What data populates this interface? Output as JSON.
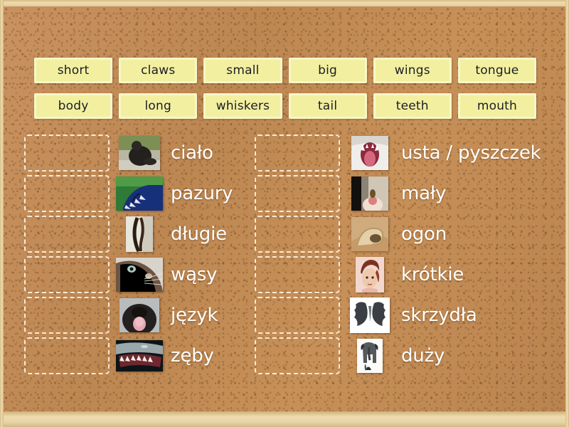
{
  "board": {
    "background": "#c48f58",
    "frame_color": "#eedcb0",
    "tile_fill": "#f2f0a0",
    "tile_border": "#f7f6c8",
    "tile_text_color": "#1d1d24",
    "term_text_color": "#ffffff",
    "dropzone_border_color": "#fff9eb"
  },
  "word_bank": {
    "row1": [
      {
        "label": "short"
      },
      {
        "label": "claws"
      },
      {
        "label": "small"
      },
      {
        "label": "big"
      },
      {
        "label": "wings"
      },
      {
        "label": "tongue"
      }
    ],
    "row2": [
      {
        "label": "body"
      },
      {
        "label": "long"
      },
      {
        "label": "whiskers"
      },
      {
        "label": "tail"
      },
      {
        "label": "teeth"
      },
      {
        "label": "mouth"
      }
    ]
  },
  "columns": {
    "left": [
      {
        "term": "ciało",
        "image": "gorilla-body-photo"
      },
      {
        "term": "pazury",
        "image": "blue-claws-photo"
      },
      {
        "term": "długie",
        "image": "long-hair-photo"
      },
      {
        "term": "wąsy",
        "image": "cat-whiskers-photo"
      },
      {
        "term": "język",
        "image": "dog-tongue-photo"
      },
      {
        "term": "zęby",
        "image": "shark-teeth-photo"
      }
    ],
    "right": [
      {
        "term": "usta / pyszczek",
        "image": "cat-open-mouth-photo"
      },
      {
        "term": "mały",
        "image": "small-object-in-fingers-photo"
      },
      {
        "term": "ogon",
        "image": "lion-tail-photo"
      },
      {
        "term": "krótkie",
        "image": "short-hair-woman-photo"
      },
      {
        "term": "skrzydła",
        "image": "bat-wings-photo"
      },
      {
        "term": "duży",
        "image": "big-elephant-silhouette-photo"
      }
    ]
  }
}
